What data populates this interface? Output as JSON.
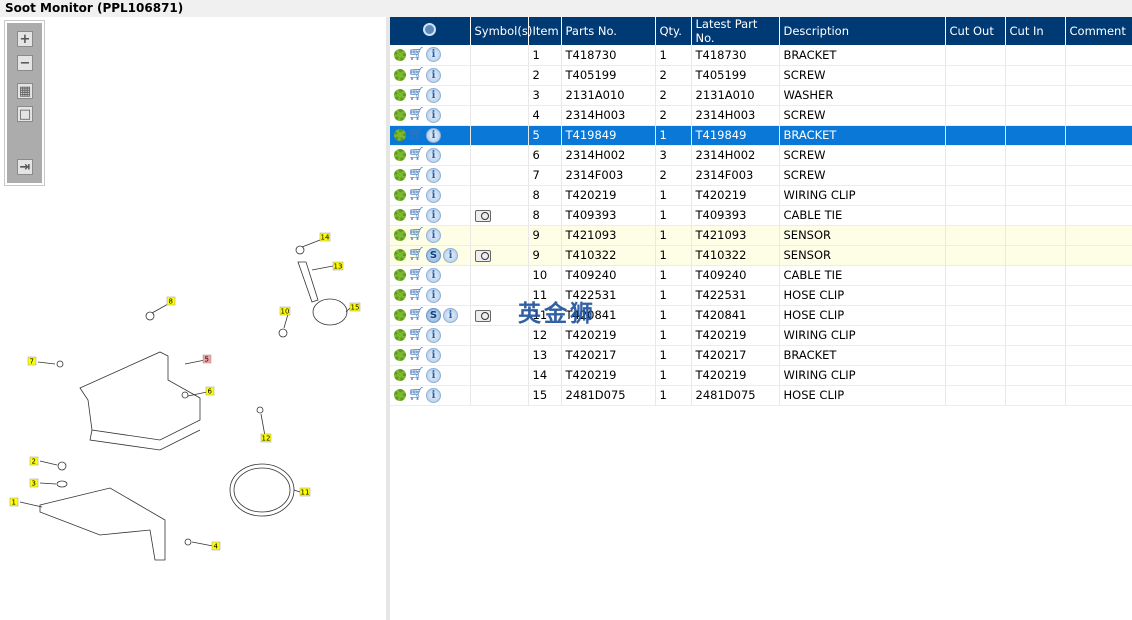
{
  "window": {
    "title": "Soot Monitor (PPL106871)"
  },
  "toolbar": {
    "buttons": [
      {
        "name": "zoom-in",
        "glyph": "+"
      },
      {
        "name": "zoom-out",
        "glyph": "−"
      },
      {
        "name": "fit-all",
        "glyph": "▦"
      },
      {
        "name": "actual-size",
        "glyph": "□"
      },
      {
        "name": "show-list",
        "glyph": "⇥"
      }
    ]
  },
  "diagram": {
    "callouts": [
      "1",
      "2",
      "3",
      "4",
      "5",
      "6",
      "7",
      "8",
      "10",
      "11",
      "12",
      "13",
      "14",
      "15"
    ]
  },
  "table": {
    "columns": [
      "",
      "Symbol(s)",
      "Item",
      "Parts No.",
      "Qty.",
      "Latest Part No.",
      "Description",
      "Cut Out",
      "Cut In",
      "Comment"
    ],
    "rows": [
      {
        "item": "1",
        "part": "T418730",
        "qty": "1",
        "latest": "T418730",
        "desc": "BRACKET",
        "s": false,
        "book": false,
        "state": ""
      },
      {
        "item": "2",
        "part": "T405199",
        "qty": "2",
        "latest": "T405199",
        "desc": "SCREW",
        "s": false,
        "book": false,
        "state": ""
      },
      {
        "item": "3",
        "part": "2131A010",
        "qty": "2",
        "latest": "2131A010",
        "desc": "WASHER",
        "s": false,
        "book": false,
        "state": ""
      },
      {
        "item": "4",
        "part": "2314H003",
        "qty": "2",
        "latest": "2314H003",
        "desc": "SCREW",
        "s": false,
        "book": false,
        "state": ""
      },
      {
        "item": "5",
        "part": "T419849",
        "qty": "1",
        "latest": "T419849",
        "desc": "BRACKET",
        "s": false,
        "book": false,
        "state": "sel"
      },
      {
        "item": "6",
        "part": "2314H002",
        "qty": "3",
        "latest": "2314H002",
        "desc": "SCREW",
        "s": false,
        "book": false,
        "state": ""
      },
      {
        "item": "7",
        "part": "2314F003",
        "qty": "2",
        "latest": "2314F003",
        "desc": "SCREW",
        "s": false,
        "book": false,
        "state": ""
      },
      {
        "item": "8",
        "part": "T420219",
        "qty": "1",
        "latest": "T420219",
        "desc": "WIRING CLIP",
        "s": false,
        "book": false,
        "state": ""
      },
      {
        "item": "8",
        "part": "T409393",
        "qty": "1",
        "latest": "T409393",
        "desc": "CABLE TIE",
        "s": false,
        "book": true,
        "state": ""
      },
      {
        "item": "9",
        "part": "T421093",
        "qty": "1",
        "latest": "T421093",
        "desc": "SENSOR",
        "s": false,
        "book": false,
        "state": "yellow"
      },
      {
        "item": "9",
        "part": "T410322",
        "qty": "1",
        "latest": "T410322",
        "desc": "SENSOR",
        "s": true,
        "book": true,
        "state": "yellow"
      },
      {
        "item": "10",
        "part": "T409240",
        "qty": "1",
        "latest": "T409240",
        "desc": "CABLE TIE",
        "s": false,
        "book": false,
        "state": ""
      },
      {
        "item": "11",
        "part": "T422531",
        "qty": "1",
        "latest": "T422531",
        "desc": "HOSE CLIP",
        "s": false,
        "book": false,
        "state": ""
      },
      {
        "item": "11",
        "part": "T420841",
        "qty": "1",
        "latest": "T420841",
        "desc": "HOSE CLIP",
        "s": true,
        "book": true,
        "state": ""
      },
      {
        "item": "12",
        "part": "T420219",
        "qty": "1",
        "latest": "T420219",
        "desc": "WIRING CLIP",
        "s": false,
        "book": false,
        "state": ""
      },
      {
        "item": "13",
        "part": "T420217",
        "qty": "1",
        "latest": "T420217",
        "desc": "BRACKET",
        "s": false,
        "book": false,
        "state": ""
      },
      {
        "item": "14",
        "part": "T420219",
        "qty": "1",
        "latest": "T420219",
        "desc": "WIRING CLIP",
        "s": false,
        "book": false,
        "state": ""
      },
      {
        "item": "15",
        "part": "2481D075",
        "qty": "1",
        "latest": "2481D075",
        "desc": "HOSE CLIP",
        "s": false,
        "book": false,
        "state": ""
      }
    ]
  },
  "watermark": "英金狮",
  "colors": {
    "header": "#003a75",
    "selected": "#0a78d7",
    "highlight": "#fefee6"
  }
}
